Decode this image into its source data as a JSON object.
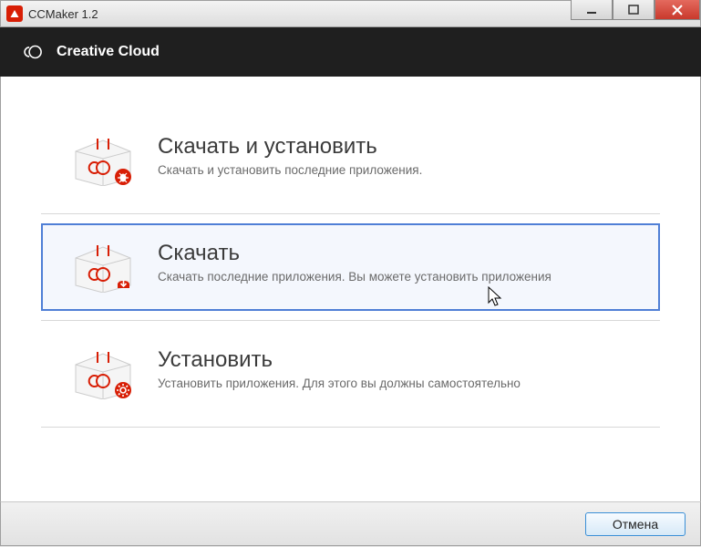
{
  "window": {
    "title": "CCMaker 1.2"
  },
  "header": {
    "title": "Creative Cloud"
  },
  "options": [
    {
      "title": "Скачать и установить",
      "desc": "Скачать и установить последние приложения.",
      "badge": "bug"
    },
    {
      "title": "Скачать",
      "desc": "Скачать последние приложения. Вы можете установить приложения",
      "badge": "download"
    },
    {
      "title": "Установить",
      "desc": "Установить приложения. Для этого вы должны самостоятельно",
      "badge": "gear"
    }
  ],
  "footer": {
    "cancel": "Отмена"
  }
}
